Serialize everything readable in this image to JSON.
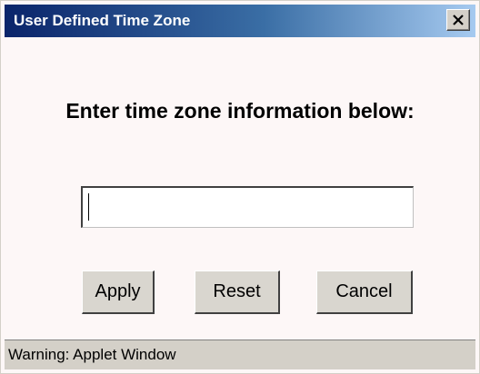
{
  "window": {
    "title": "User Defined Time Zone",
    "close_icon": "close-icon",
    "titlebar_color": "#0a246a"
  },
  "dialog": {
    "heading": "Enter time zone information below:",
    "input": {
      "value": "",
      "placeholder": ""
    }
  },
  "buttons": {
    "apply_label": "Apply",
    "reset_label": "Reset",
    "cancel_label": "Cancel"
  },
  "status": {
    "text": "Warning: Applet Window"
  }
}
